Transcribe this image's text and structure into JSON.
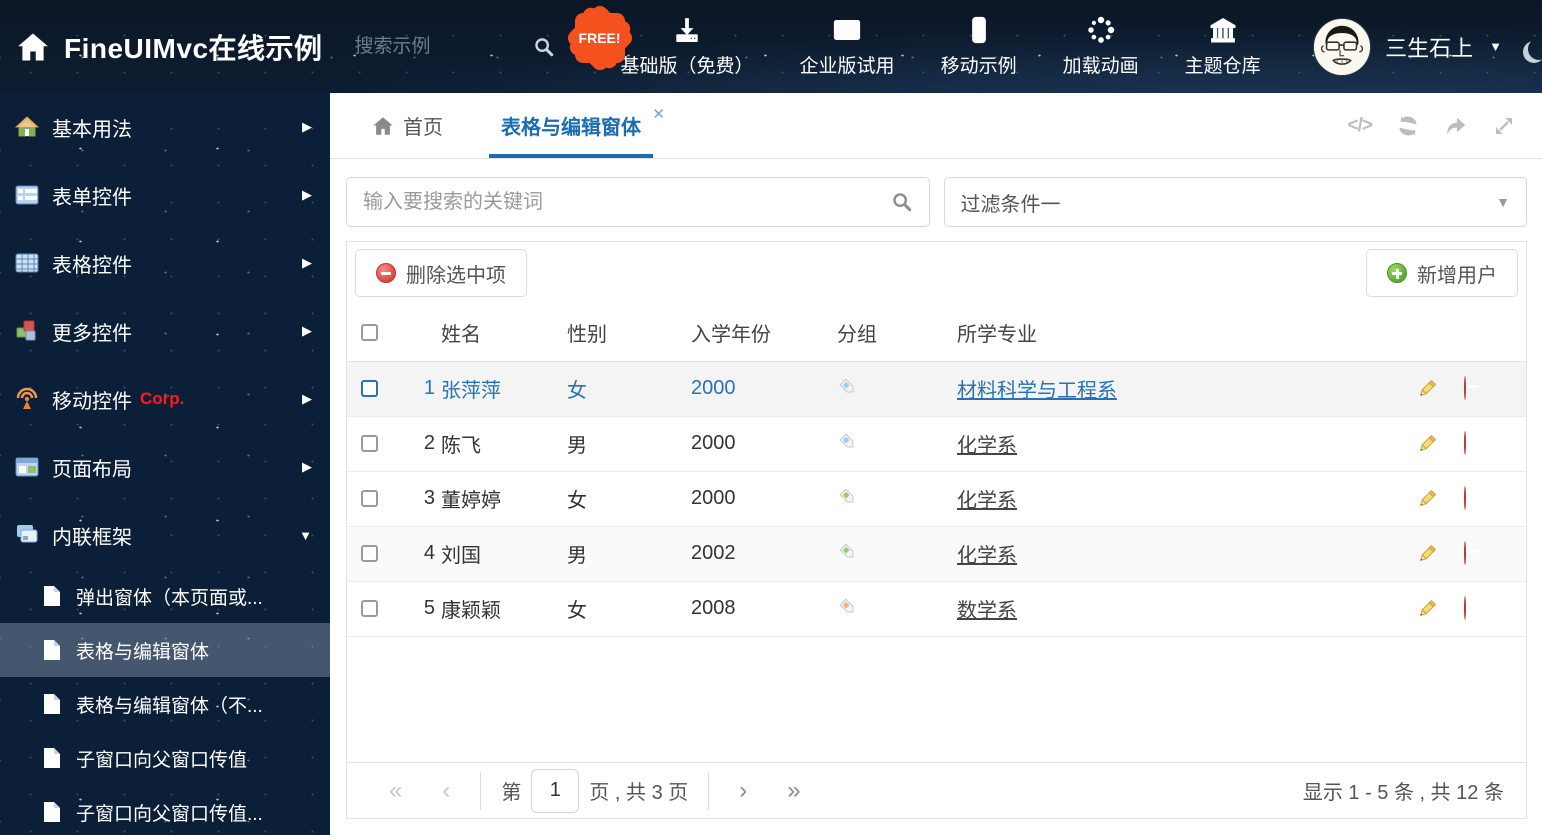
{
  "header": {
    "logo_title": "FineUIMvc在线示例",
    "search_placeholder": "搜索示例",
    "nav": [
      {
        "label": "基础版（免费）",
        "icon": "download-icon",
        "badge": "FREE!"
      },
      {
        "label": "企业版试用",
        "icon": "mail-icon"
      },
      {
        "label": "移动示例",
        "icon": "mobile-icon"
      },
      {
        "label": "加载动画",
        "icon": "spinner-icon"
      },
      {
        "label": "主题仓库",
        "icon": "bank-icon"
      }
    ],
    "user_name": "三生石上"
  },
  "sidebar": {
    "items": [
      {
        "label": "基本用法",
        "icon": "home-icon"
      },
      {
        "label": "表单控件",
        "icon": "form-icon"
      },
      {
        "label": "表格控件",
        "icon": "table-icon"
      },
      {
        "label": "更多控件",
        "icon": "cubes-icon"
      },
      {
        "label": "移动控件",
        "tag": "Corp.",
        "icon": "antenna-icon"
      },
      {
        "label": "页面布局",
        "icon": "layout-icon"
      },
      {
        "label": "内联框架",
        "icon": "frames-icon",
        "expanded": true
      }
    ],
    "children": [
      {
        "label": "弹出窗体（本页面或..."
      },
      {
        "label": "表格与编辑窗体",
        "selected": true
      },
      {
        "label": "表格与编辑窗体（不..."
      },
      {
        "label": "子窗口向父窗口传值"
      },
      {
        "label": "子窗口向父窗口传值..."
      }
    ]
  },
  "tabs": [
    {
      "label": "首页",
      "icon": "home-icon"
    },
    {
      "label": "表格与编辑窗体",
      "active": true,
      "closable": true
    }
  ],
  "filters": {
    "search_placeholder": "输入要搜索的关键词",
    "filter_selected": "过滤条件一"
  },
  "grid": {
    "delete_button": "删除选中项",
    "add_button": "新增用户",
    "columns": {
      "name": "姓名",
      "gender": "性别",
      "year": "入学年份",
      "group": "分组",
      "major": "所学专业"
    },
    "rows": [
      {
        "num": "1",
        "name": "张萍萍",
        "gender": "女",
        "year": "2000",
        "tag_color": "#9ccef2",
        "major": "材料科学与工程系",
        "selected": true
      },
      {
        "num": "2",
        "name": "陈飞",
        "gender": "男",
        "year": "2000",
        "tag_color": "#9ccef2",
        "major": "化学系"
      },
      {
        "num": "3",
        "name": "董婷婷",
        "gender": "女",
        "year": "2000",
        "tag_color": "#97cf62",
        "major": "化学系"
      },
      {
        "num": "4",
        "name": "刘国",
        "gender": "男",
        "year": "2002",
        "tag_color": "#97cf62",
        "major": "化学系"
      },
      {
        "num": "5",
        "name": "康颖颖",
        "gender": "女",
        "year": "2008",
        "tag_color": "#f6b46e",
        "major": "数学系"
      }
    ]
  },
  "pagination": {
    "page_prefix": "第",
    "page_value": "1",
    "page_suffix": "页 , 共 3 页",
    "summary": "显示 1 - 5 条 , 共 12 条"
  },
  "colors": {
    "accent_blue": "#1b6cb3",
    "selected_row_text": "#2573b5",
    "corp_red": "#ff1a1a",
    "free_badge": "#f4511e",
    "delete_red": "#d8453b",
    "add_green": "#58a733"
  }
}
